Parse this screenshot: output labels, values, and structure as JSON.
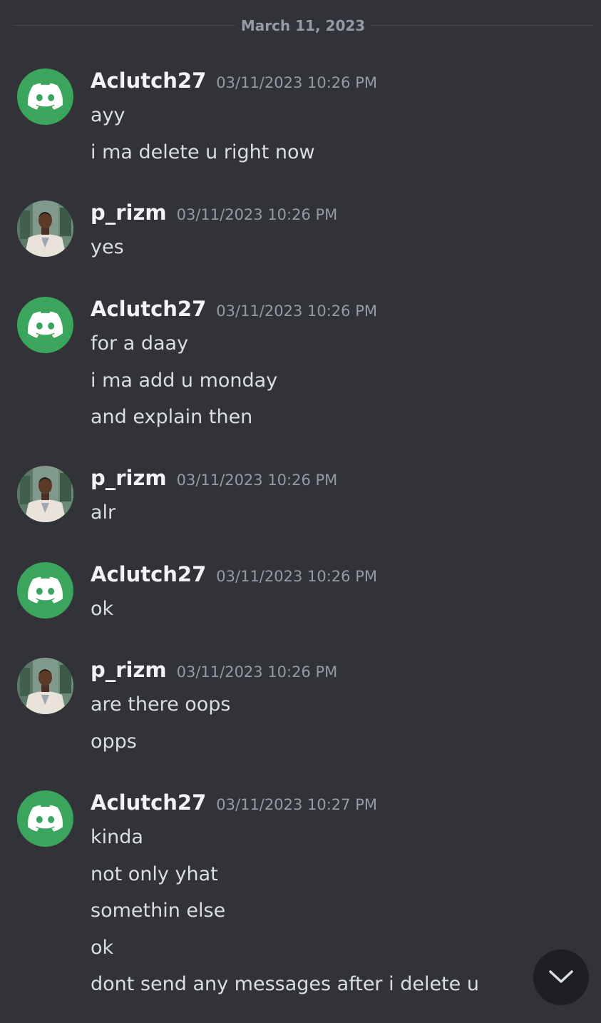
{
  "date_divider": "March 11, 2023",
  "messages": [
    {
      "username": "Aclutch27",
      "avatar": "discord-logo-icon",
      "timestamp": "03/11/2023 10:26 PM",
      "lines": [
        "ayy",
        "i ma delete u right now"
      ]
    },
    {
      "username": "p_rizm",
      "avatar": "user-photo",
      "timestamp": "03/11/2023 10:26 PM",
      "lines": [
        "yes"
      ]
    },
    {
      "username": "Aclutch27",
      "avatar": "discord-logo-icon",
      "timestamp": "03/11/2023 10:26 PM",
      "lines": [
        "for a daay",
        "i ma add u monday",
        "and explain then"
      ]
    },
    {
      "username": "p_rizm",
      "avatar": "user-photo",
      "timestamp": "03/11/2023 10:26 PM",
      "lines": [
        "alr"
      ]
    },
    {
      "username": "Aclutch27",
      "avatar": "discord-logo-icon",
      "timestamp": "03/11/2023 10:26 PM",
      "lines": [
        "ok"
      ]
    },
    {
      "username": "p_rizm",
      "avatar": "user-photo",
      "timestamp": "03/11/2023 10:26 PM",
      "lines": [
        "are there oops",
        "opps"
      ]
    },
    {
      "username": "Aclutch27",
      "avatar": "discord-logo-icon",
      "timestamp": "03/11/2023 10:27 PM",
      "lines": [
        "kinda",
        "not only yhat",
        "somethin else",
        "ok",
        "dont send any messages after i delete u"
      ]
    }
  ],
  "jump_button_icon": "chevron-down-icon",
  "colors": {
    "background": "#313338",
    "discord_green": "#3ba55d",
    "username": "#f2f3f5",
    "timestamp": "#949ba4",
    "message_text": "#dbdee1"
  }
}
